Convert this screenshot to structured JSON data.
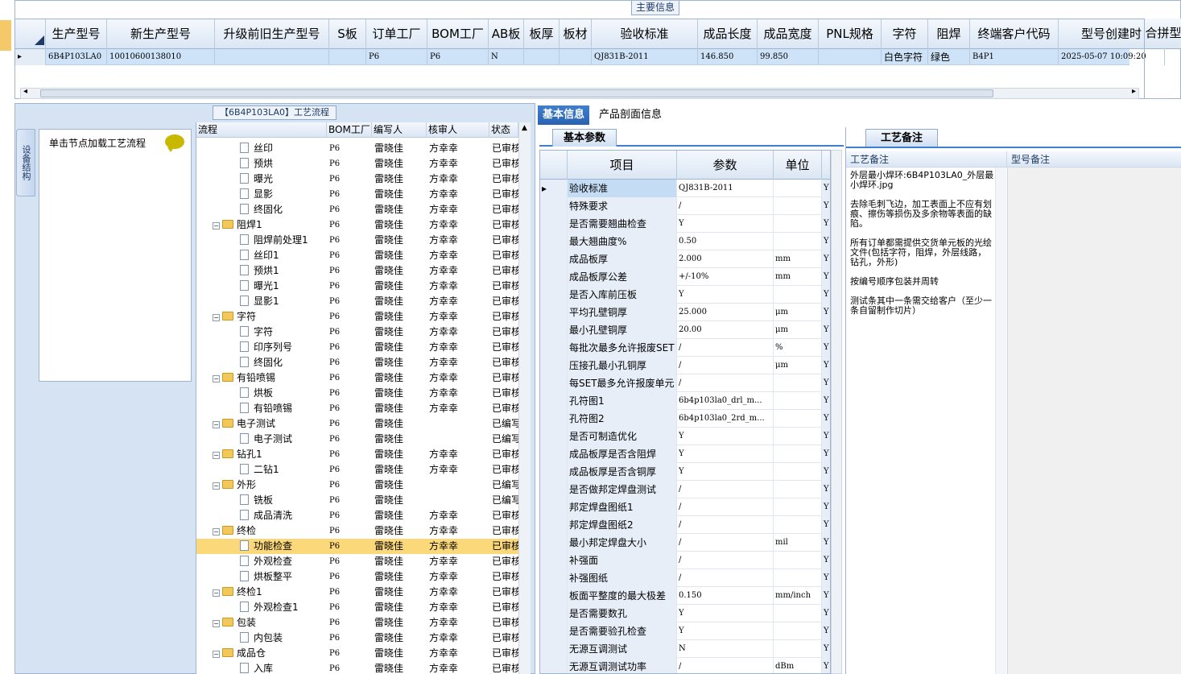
{
  "top": {
    "title": "主要信息",
    "columns": [
      "生产型号",
      "新生产型号",
      "升级前旧生产型号",
      "S板",
      "订单工厂",
      "BOM工厂",
      "AB板",
      "板厚",
      "板材",
      "验收标准",
      "成品长度",
      "成品宽度",
      "PNL规格",
      "字符",
      "阻焊",
      "终端客户代码",
      "型号创建时"
    ],
    "row": [
      "6B4P103LA0",
      "10010600138010",
      "",
      "",
      "P6",
      "P6",
      "N",
      "",
      "",
      "QJ831B-2011",
      "146.850",
      "99.850",
      "",
      "白色字符",
      "绿色",
      "B4P1",
      "2025-05-07 10:09:20"
    ],
    "merge": "合拼型"
  },
  "left": {
    "side_tab": "设备结构",
    "process_title": "【6B4P103LA0】工艺流程",
    "node_hint": "单击节点加载工艺流程"
  },
  "tree": {
    "headers": [
      "流程",
      "BOM工厂",
      "编写人",
      "核审人",
      "状态"
    ],
    "rows": [
      {
        "indent": 2,
        "type": "doc",
        "name": "丝印",
        "bom": "P6",
        "writer": "雷晓佳",
        "reviewer": "方幸幸",
        "status": "已审核"
      },
      {
        "indent": 2,
        "type": "doc",
        "name": "预烘",
        "bom": "P6",
        "writer": "雷晓佳",
        "reviewer": "方幸幸",
        "status": "已审核"
      },
      {
        "indent": 2,
        "type": "doc",
        "name": "曝光",
        "bom": "P6",
        "writer": "雷晓佳",
        "reviewer": "方幸幸",
        "status": "已审核"
      },
      {
        "indent": 2,
        "type": "doc",
        "name": "显影",
        "bom": "P6",
        "writer": "雷晓佳",
        "reviewer": "方幸幸",
        "status": "已审核"
      },
      {
        "indent": 2,
        "type": "doc",
        "name": "终固化",
        "bom": "P6",
        "writer": "雷晓佳",
        "reviewer": "方幸幸",
        "status": "已审核"
      },
      {
        "indent": 1,
        "type": "folder",
        "name": "阻焊1",
        "bom": "P6",
        "writer": "雷晓佳",
        "reviewer": "方幸幸",
        "status": "已审核"
      },
      {
        "indent": 2,
        "type": "doc",
        "name": "阻焊前处理1",
        "bom": "P6",
        "writer": "雷晓佳",
        "reviewer": "方幸幸",
        "status": "已审核"
      },
      {
        "indent": 2,
        "type": "doc",
        "name": "丝印1",
        "bom": "P6",
        "writer": "雷晓佳",
        "reviewer": "方幸幸",
        "status": "已审核"
      },
      {
        "indent": 2,
        "type": "doc",
        "name": "预烘1",
        "bom": "P6",
        "writer": "雷晓佳",
        "reviewer": "方幸幸",
        "status": "已审核"
      },
      {
        "indent": 2,
        "type": "doc",
        "name": "曝光1",
        "bom": "P6",
        "writer": "雷晓佳",
        "reviewer": "方幸幸",
        "status": "已审核"
      },
      {
        "indent": 2,
        "type": "doc",
        "name": "显影1",
        "bom": "P6",
        "writer": "雷晓佳",
        "reviewer": "方幸幸",
        "status": "已审核"
      },
      {
        "indent": 1,
        "type": "folder",
        "name": "字符",
        "bom": "P6",
        "writer": "雷晓佳",
        "reviewer": "方幸幸",
        "status": "已审核"
      },
      {
        "indent": 2,
        "type": "doc",
        "name": "字符",
        "bom": "P6",
        "writer": "雷晓佳",
        "reviewer": "方幸幸",
        "status": "已审核"
      },
      {
        "indent": 2,
        "type": "doc",
        "name": "印序列号",
        "bom": "P6",
        "writer": "雷晓佳",
        "reviewer": "方幸幸",
        "status": "已审核"
      },
      {
        "indent": 2,
        "type": "doc",
        "name": "终固化",
        "bom": "P6",
        "writer": "雷晓佳",
        "reviewer": "方幸幸",
        "status": "已审核"
      },
      {
        "indent": 1,
        "type": "folder",
        "name": "有铅喷锡",
        "bom": "P6",
        "writer": "雷晓佳",
        "reviewer": "方幸幸",
        "status": "已审核"
      },
      {
        "indent": 2,
        "type": "doc",
        "name": "烘板",
        "bom": "P6",
        "writer": "雷晓佳",
        "reviewer": "方幸幸",
        "status": "已审核"
      },
      {
        "indent": 2,
        "type": "doc",
        "name": "有铅喷锡",
        "bom": "P6",
        "writer": "雷晓佳",
        "reviewer": "方幸幸",
        "status": "已审核"
      },
      {
        "indent": 1,
        "type": "folder",
        "name": "电子测试",
        "bom": "P6",
        "writer": "雷晓佳",
        "reviewer": "",
        "status": "已编写"
      },
      {
        "indent": 2,
        "type": "doc",
        "name": "电子测试",
        "bom": "P6",
        "writer": "雷晓佳",
        "reviewer": "",
        "status": "已编写"
      },
      {
        "indent": 1,
        "type": "folder",
        "name": "钻孔1",
        "bom": "P6",
        "writer": "雷晓佳",
        "reviewer": "方幸幸",
        "status": "已审核"
      },
      {
        "indent": 2,
        "type": "doc",
        "name": "二钻1",
        "bom": "P6",
        "writer": "雷晓佳",
        "reviewer": "方幸幸",
        "status": "已审核"
      },
      {
        "indent": 1,
        "type": "folder",
        "name": "外形",
        "bom": "P6",
        "writer": "雷晓佳",
        "reviewer": "",
        "status": "已编写"
      },
      {
        "indent": 2,
        "type": "doc",
        "name": "铣板",
        "bom": "P6",
        "writer": "雷晓佳",
        "reviewer": "",
        "status": "已编写"
      },
      {
        "indent": 2,
        "type": "doc",
        "name": "成品清洗",
        "bom": "P6",
        "writer": "雷晓佳",
        "reviewer": "方幸幸",
        "status": "已审核"
      },
      {
        "indent": 1,
        "type": "folder",
        "name": "终检",
        "bom": "P6",
        "writer": "雷晓佳",
        "reviewer": "方幸幸",
        "status": "已审核"
      },
      {
        "indent": 2,
        "type": "doc",
        "name": "功能检查",
        "bom": "P6",
        "writer": "雷晓佳",
        "reviewer": "方幸幸",
        "status": "已审核",
        "selected": true
      },
      {
        "indent": 2,
        "type": "doc",
        "name": "外观检查",
        "bom": "P6",
        "writer": "雷晓佳",
        "reviewer": "方幸幸",
        "status": "已审核"
      },
      {
        "indent": 2,
        "type": "doc",
        "name": "烘板整平",
        "bom": "P6",
        "writer": "雷晓佳",
        "reviewer": "方幸幸",
        "status": "已审核"
      },
      {
        "indent": 1,
        "type": "folder",
        "name": "终检1",
        "bom": "P6",
        "writer": "雷晓佳",
        "reviewer": "方幸幸",
        "status": "已审核"
      },
      {
        "indent": 2,
        "type": "doc",
        "name": "外观检查1",
        "bom": "P6",
        "writer": "雷晓佳",
        "reviewer": "方幸幸",
        "status": "已审核"
      },
      {
        "indent": 1,
        "type": "folder",
        "name": "包装",
        "bom": "P6",
        "writer": "雷晓佳",
        "reviewer": "方幸幸",
        "status": "已审核"
      },
      {
        "indent": 2,
        "type": "doc",
        "name": "内包装",
        "bom": "P6",
        "writer": "雷晓佳",
        "reviewer": "方幸幸",
        "status": "已审核"
      },
      {
        "indent": 1,
        "type": "folder",
        "name": "成品仓",
        "bom": "P6",
        "writer": "雷晓佳",
        "reviewer": "方幸幸",
        "status": "已审核"
      },
      {
        "indent": 2,
        "type": "doc",
        "name": "入库",
        "bom": "P6",
        "writer": "雷晓佳",
        "reviewer": "方幸幸",
        "status": "已审核"
      }
    ]
  },
  "mid": {
    "tabs": [
      "基本信息",
      "产品剖面信息"
    ],
    "sub_tab": "基本参数",
    "headers": [
      "项目",
      "参数",
      "单位"
    ],
    "rows": [
      {
        "item": "验收标准",
        "param": "QJ831B-2011",
        "unit": "",
        "flag": "Y"
      },
      {
        "item": "特殊要求",
        "param": "/",
        "unit": "",
        "flag": "Y"
      },
      {
        "item": "是否需要翘曲检查",
        "param": "Y",
        "unit": "",
        "flag": "Y"
      },
      {
        "item": "最大翘曲度%",
        "param": "0.50",
        "unit": "",
        "flag": "Y"
      },
      {
        "item": "成品板厚",
        "param": "2.000",
        "unit": "mm",
        "flag": "Y"
      },
      {
        "item": "成品板厚公差",
        "param": "+/-10%",
        "unit": "mm",
        "flag": "Y"
      },
      {
        "item": "是否入库前压板",
        "param": "Y",
        "unit": "",
        "flag": "Y"
      },
      {
        "item": "平均孔壁铜厚",
        "param": "25.000",
        "unit": "μm",
        "flag": "Y"
      },
      {
        "item": "最小孔壁铜厚",
        "param": "20.00",
        "unit": "μm",
        "flag": "Y"
      },
      {
        "item": "每批次最多允许报废SET",
        "param": "/",
        "unit": "%",
        "flag": "Y"
      },
      {
        "item": "压接孔最小孔铜厚",
        "param": "/",
        "unit": "μm",
        "flag": "Y"
      },
      {
        "item": "每SET最多允许报废单元",
        "param": "/",
        "unit": "",
        "flag": "Y"
      },
      {
        "item": "孔符图1",
        "param": "6b4p103la0_drl_m...",
        "unit": "",
        "flag": "Y"
      },
      {
        "item": "孔符图2",
        "param": "6b4p103la0_2rd_m...",
        "unit": "",
        "flag": "Y"
      },
      {
        "item": "是否可制造优化",
        "param": "Y",
        "unit": "",
        "flag": "Y"
      },
      {
        "item": "成品板厚是否含阻焊",
        "param": "Y",
        "unit": "",
        "flag": "Y"
      },
      {
        "item": "成品板厚是否含铜厚",
        "param": "Y",
        "unit": "",
        "flag": "Y"
      },
      {
        "item": "是否做邦定焊盘测试",
        "param": "/",
        "unit": "",
        "flag": "Y"
      },
      {
        "item": "邦定焊盘图纸1",
        "param": "/",
        "unit": "",
        "flag": "Y"
      },
      {
        "item": "邦定焊盘图纸2",
        "param": "/",
        "unit": "",
        "flag": "Y"
      },
      {
        "item": "最小邦定焊盘大小",
        "param": "/",
        "unit": "mil",
        "flag": "Y"
      },
      {
        "item": "补强面",
        "param": "/",
        "unit": "",
        "flag": "Y"
      },
      {
        "item": "补强图纸",
        "param": "/",
        "unit": "",
        "flag": "Y"
      },
      {
        "item": "板面平整度的最大极差",
        "param": "0.150",
        "unit": "mm/inch",
        "flag": "Y"
      },
      {
        "item": "是否需要数孔",
        "param": "Y",
        "unit": "",
        "flag": "Y"
      },
      {
        "item": "是否需要验孔检查",
        "param": "Y",
        "unit": "",
        "flag": "Y"
      },
      {
        "item": "无源互调测试",
        "param": "N",
        "unit": "",
        "flag": "Y"
      },
      {
        "item": "无源互调测试功率",
        "param": "/",
        "unit": "dBm",
        "flag": "Y"
      }
    ]
  },
  "right": {
    "tab": "工艺备注",
    "col1": "工艺备注",
    "col2": "型号备注",
    "remark": "外层最小焊环:6B4P103LA0_外层最小焊环.jpg\n\n去除毛刺飞边，加工表面上不应有划痕、擦伤等损伤及多余物等表面的缺陷。\n\n所有订单都需提供交货单元板的光绘文件(包括字符，阻焊，外层线路，钻孔，外形)\n\n按编号顺序包装并周转\n\n测试条其中一条需交给客户（至少一条自留制作切片）"
  }
}
